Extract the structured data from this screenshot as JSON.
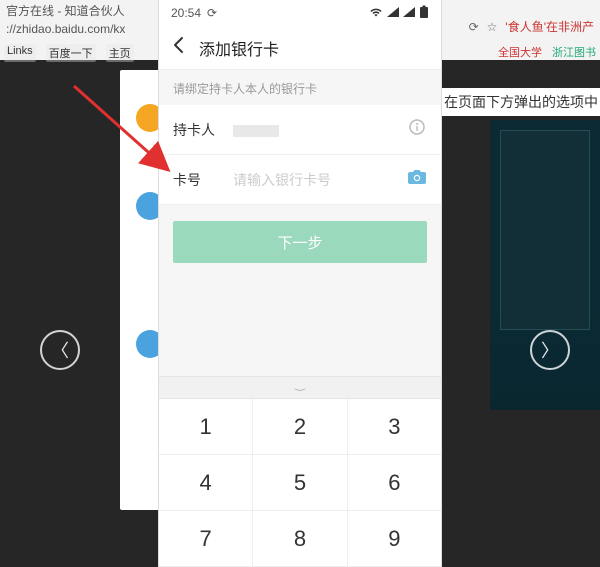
{
  "browser": {
    "tab_title": "官方在线 - 知道合伙人",
    "address": "://zhidao.baidu.com/kx",
    "bookmarks": [
      "Links",
      "百度一下",
      "主页"
    ],
    "right_label": "'食人鱼'在非洲产",
    "right_caption": "在页面下方弹出的选项中",
    "right_links": [
      "全国大学",
      "浙江图书"
    ]
  },
  "phone": {
    "status": {
      "time": "20:54",
      "refresh_icon": "⟳"
    },
    "nav_title": "添加银行卡",
    "hint": "请绑定持卡人本人的银行卡",
    "fields": {
      "holder": {
        "label": "持卡人",
        "value_masked": true
      },
      "card": {
        "label": "卡号",
        "placeholder": "请输入银行卡号"
      }
    },
    "next_label": "下一步",
    "keypad": [
      [
        "1",
        "2",
        "3"
      ],
      [
        "4",
        "5",
        "6"
      ],
      [
        "7",
        "8",
        "9"
      ]
    ]
  }
}
